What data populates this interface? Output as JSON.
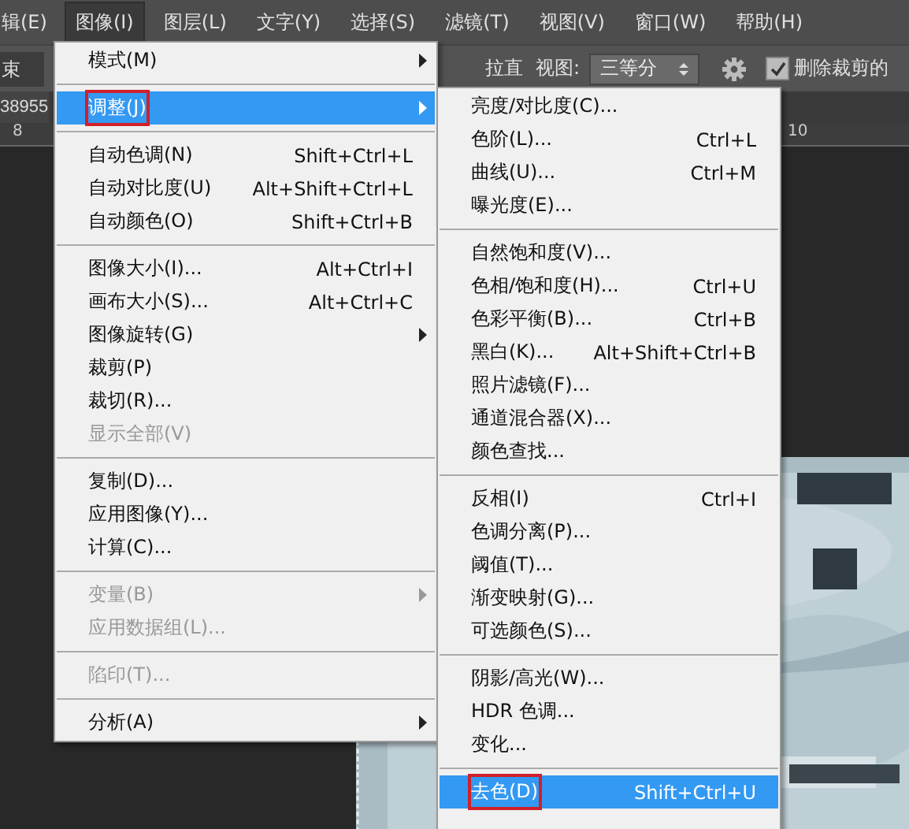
{
  "menubar": [
    {
      "label": "辑(E)",
      "selected": false
    },
    {
      "label": "图像(I)",
      "selected": true
    },
    {
      "label": "图层(L)",
      "selected": false
    },
    {
      "label": "文字(Y)",
      "selected": false
    },
    {
      "label": "选择(S)",
      "selected": false
    },
    {
      "label": "滤镜(T)",
      "selected": false
    },
    {
      "label": "视图(V)",
      "selected": false
    },
    {
      "label": "窗口(W)",
      "selected": false
    },
    {
      "label": "帮助(H)",
      "selected": false
    }
  ],
  "options_bar": {
    "field": "束",
    "straighten": "拉直",
    "view_label": "视图:",
    "view_value": "三等分",
    "delete_crop": {
      "label": "删除裁剪的",
      "checked": true
    }
  },
  "document_tab": "38955",
  "ruler": [
    "8",
    "10"
  ],
  "image_menu": [
    {
      "kind": "item",
      "label": "模式(M)",
      "submenu": true,
      "disabled": false,
      "selected": false,
      "outlined": false
    },
    {
      "kind": "separator"
    },
    {
      "kind": "item",
      "label": "调整(J)",
      "submenu": true,
      "disabled": false,
      "selected": true,
      "outlined": true
    },
    {
      "kind": "separator"
    },
    {
      "kind": "item",
      "label": "自动色调(N)",
      "shortcut": "Shift+Ctrl+L",
      "submenu": false,
      "disabled": false,
      "selected": false,
      "outlined": false
    },
    {
      "kind": "item",
      "label": "自动对比度(U)",
      "shortcut": "Alt+Shift+Ctrl+L",
      "submenu": false,
      "disabled": false,
      "selected": false,
      "outlined": false
    },
    {
      "kind": "item",
      "label": "自动颜色(O)",
      "shortcut": "Shift+Ctrl+B",
      "submenu": false,
      "disabled": false,
      "selected": false,
      "outlined": false
    },
    {
      "kind": "separator"
    },
    {
      "kind": "item",
      "label": "图像大小(I)...",
      "shortcut": "Alt+Ctrl+I",
      "submenu": false,
      "disabled": false,
      "selected": false,
      "outlined": false
    },
    {
      "kind": "item",
      "label": "画布大小(S)...",
      "shortcut": "Alt+Ctrl+C",
      "submenu": false,
      "disabled": false,
      "selected": false,
      "outlined": false
    },
    {
      "kind": "item",
      "label": "图像旋转(G)",
      "submenu": true,
      "disabled": false,
      "selected": false,
      "outlined": false
    },
    {
      "kind": "item",
      "label": "裁剪(P)",
      "submenu": false,
      "disabled": false,
      "selected": false,
      "outlined": false
    },
    {
      "kind": "item",
      "label": "裁切(R)...",
      "submenu": false,
      "disabled": false,
      "selected": false,
      "outlined": false
    },
    {
      "kind": "item",
      "label": "显示全部(V)",
      "submenu": false,
      "disabled": true,
      "selected": false,
      "outlined": false
    },
    {
      "kind": "separator"
    },
    {
      "kind": "item",
      "label": "复制(D)...",
      "submenu": false,
      "disabled": false,
      "selected": false,
      "outlined": false
    },
    {
      "kind": "item",
      "label": "应用图像(Y)...",
      "submenu": false,
      "disabled": false,
      "selected": false,
      "outlined": false
    },
    {
      "kind": "item",
      "label": "计算(C)...",
      "submenu": false,
      "disabled": false,
      "selected": false,
      "outlined": false
    },
    {
      "kind": "separator"
    },
    {
      "kind": "item",
      "label": "变量(B)",
      "submenu": true,
      "disabled": true,
      "selected": false,
      "outlined": false
    },
    {
      "kind": "item",
      "label": "应用数据组(L)...",
      "submenu": false,
      "disabled": true,
      "selected": false,
      "outlined": false
    },
    {
      "kind": "separator"
    },
    {
      "kind": "item",
      "label": "陷印(T)...",
      "submenu": false,
      "disabled": true,
      "selected": false,
      "outlined": false
    },
    {
      "kind": "separator"
    },
    {
      "kind": "item",
      "label": "分析(A)",
      "submenu": true,
      "disabled": false,
      "selected": false,
      "outlined": false
    }
  ],
  "adjust_submenu": [
    {
      "kind": "item",
      "label": "亮度/对比度(C)...",
      "selected": false,
      "outlined": false
    },
    {
      "kind": "item",
      "label": "色阶(L)...",
      "shortcut": "Ctrl+L",
      "selected": false,
      "outlined": false
    },
    {
      "kind": "item",
      "label": "曲线(U)...",
      "shortcut": "Ctrl+M",
      "selected": false,
      "outlined": false
    },
    {
      "kind": "item",
      "label": "曝光度(E)...",
      "selected": false,
      "outlined": false
    },
    {
      "kind": "separator"
    },
    {
      "kind": "item",
      "label": "自然饱和度(V)...",
      "selected": false,
      "outlined": false
    },
    {
      "kind": "item",
      "label": "色相/饱和度(H)...",
      "shortcut": "Ctrl+U",
      "selected": false,
      "outlined": false
    },
    {
      "kind": "item",
      "label": "色彩平衡(B)...",
      "shortcut": "Ctrl+B",
      "selected": false,
      "outlined": false
    },
    {
      "kind": "item",
      "label": "黑白(K)...",
      "shortcut": "Alt+Shift+Ctrl+B",
      "selected": false,
      "outlined": false
    },
    {
      "kind": "item",
      "label": "照片滤镜(F)...",
      "selected": false,
      "outlined": false
    },
    {
      "kind": "item",
      "label": "通道混合器(X)...",
      "selected": false,
      "outlined": false
    },
    {
      "kind": "item",
      "label": "颜色查找...",
      "selected": false,
      "outlined": false
    },
    {
      "kind": "separator"
    },
    {
      "kind": "item",
      "label": "反相(I)",
      "shortcut": "Ctrl+I",
      "selected": false,
      "outlined": false
    },
    {
      "kind": "item",
      "label": "色调分离(P)...",
      "selected": false,
      "outlined": false
    },
    {
      "kind": "item",
      "label": "阈值(T)...",
      "selected": false,
      "outlined": false
    },
    {
      "kind": "item",
      "label": "渐变映射(G)...",
      "selected": false,
      "outlined": false
    },
    {
      "kind": "item",
      "label": "可选颜色(S)...",
      "selected": false,
      "outlined": false
    },
    {
      "kind": "separator"
    },
    {
      "kind": "item",
      "label": "阴影/高光(W)...",
      "selected": false,
      "outlined": false
    },
    {
      "kind": "item",
      "label": "HDR 色调...",
      "selected": false,
      "outlined": false
    },
    {
      "kind": "item",
      "label": "变化...",
      "selected": false,
      "outlined": false
    },
    {
      "kind": "separator"
    },
    {
      "kind": "item",
      "label": "去色(D)",
      "shortcut": "Shift+Ctrl+U",
      "selected": true,
      "outlined": true
    }
  ]
}
